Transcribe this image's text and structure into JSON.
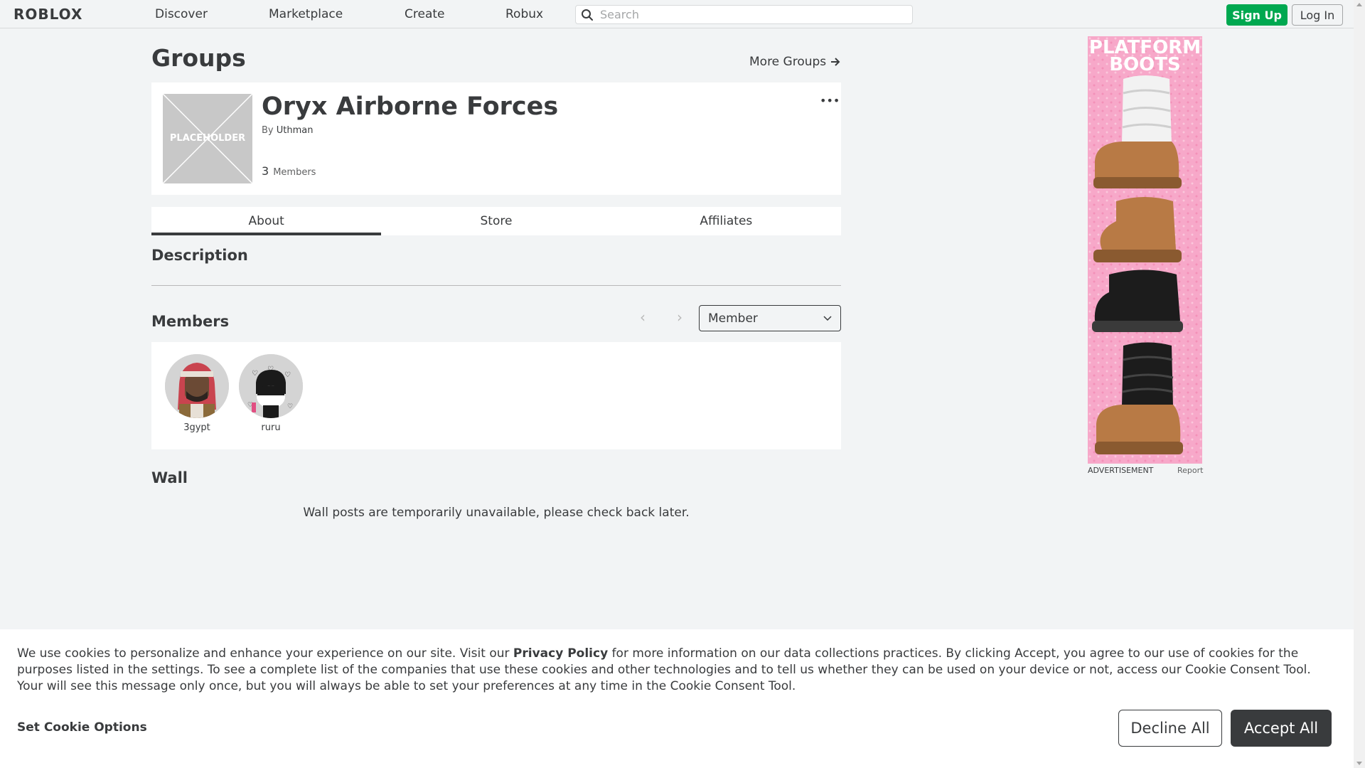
{
  "nav": {
    "logo": "ROBLOX",
    "links": [
      "Discover",
      "Marketplace",
      "Create",
      "Robux"
    ],
    "search_placeholder": "Search",
    "signup_label": "Sign Up",
    "login_label": "Log In"
  },
  "header": {
    "title": "Groups",
    "more_groups": "More Groups"
  },
  "group": {
    "placeholder_label": "PLACEHOLDER",
    "name": "Oryx Airborne Forces",
    "by_label": "By",
    "owner": "Uthman",
    "member_count": "3",
    "members_label": "Members",
    "more_menu": "•••"
  },
  "tabs": [
    {
      "label": "About",
      "active": true
    },
    {
      "label": "Store",
      "active": false
    },
    {
      "label": "Affiliates",
      "active": false
    }
  ],
  "sections": {
    "description": "Description",
    "members": "Members",
    "wall": "Wall"
  },
  "members_panel": {
    "role_filter": "Member",
    "list": [
      {
        "username": "3gypt"
      },
      {
        "username": "ruru"
      }
    ]
  },
  "wall": {
    "message": "Wall posts are temporarily unavailable, please check back later."
  },
  "ad": {
    "headline": "PLATFORM BOOTS",
    "caption": "ADVERTISEMENT",
    "report": "Report"
  },
  "cookie": {
    "text_before": "We use cookies to personalize and enhance your experience on our site. Visit our ",
    "privacy_link": "Privacy Policy",
    "text_after": " for more information on our data collections practices. By clicking Accept, you agree to our use of cookies for the purposes listed in the settings. To see a complete list of the companies that use these cookies and other technologies and to tell us whether they can be used on your device or not, access our Cookie Consent Tool. Your will see this message only once, but you will always be able to set your preferences at any time in the Cookie Consent Tool.",
    "options_label": "Set Cookie Options",
    "decline_label": "Decline All",
    "accept_label": "Accept All"
  },
  "colors": {
    "signup_green": "#00a850",
    "text_dark": "#393b3d",
    "ad_pink": "#f7a8c9"
  }
}
